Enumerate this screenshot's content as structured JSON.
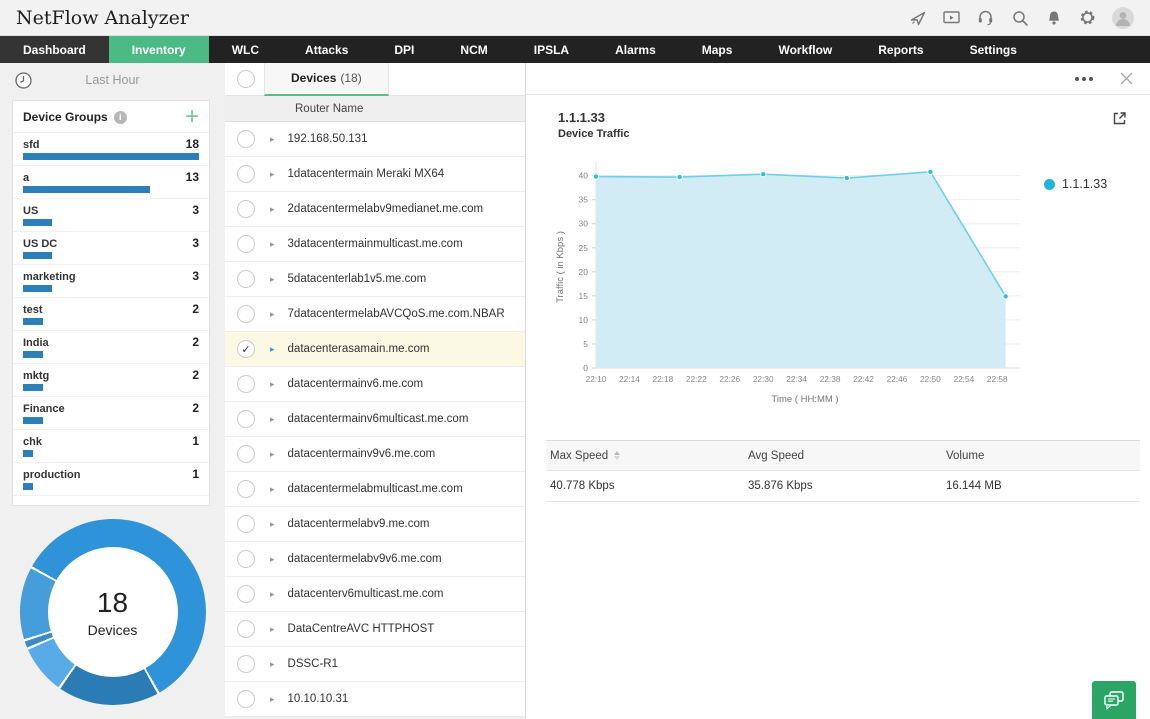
{
  "app": {
    "title": "NetFlow Analyzer"
  },
  "header": {
    "icons": [
      "rocket-icon",
      "demo-screen-icon",
      "support-headset-icon",
      "search-icon",
      "notifications-bell-icon",
      "settings-gear-icon",
      "user-avatar"
    ]
  },
  "nav": {
    "items": [
      "Dashboard",
      "Inventory",
      "WLC",
      "Attacks",
      "DPI",
      "NCM",
      "IPSLA",
      "Alarms",
      "Maps",
      "Workflow",
      "Reports",
      "Settings"
    ],
    "active_index": 1,
    "active_color": "#4cba85"
  },
  "sidebar": {
    "time_filter": {
      "label": "Last Hour"
    },
    "device_groups": {
      "title": "Device Groups",
      "info_glyph": "i",
      "add_glyph": "+",
      "bar_color": "#2d7fb9",
      "max_count": 18,
      "items": [
        {
          "label": "sfd",
          "count": 18
        },
        {
          "label": "a",
          "count": 13
        },
        {
          "label": "US",
          "count": 3
        },
        {
          "label": "US DC",
          "count": 3
        },
        {
          "label": "marketing",
          "count": 3
        },
        {
          "label": "test",
          "count": 2
        },
        {
          "label": "India",
          "count": 2
        },
        {
          "label": "mktg",
          "count": 2
        },
        {
          "label": "Finance",
          "count": 2
        },
        {
          "label": "chk",
          "count": 1
        },
        {
          "label": "production",
          "count": 1
        }
      ]
    },
    "donut": {
      "center_value": "18",
      "center_label": "Devices",
      "segments": [
        {
          "color": "#2e93d8",
          "deg": 150
        },
        {
          "color": "#2b7cb5",
          "deg": 63
        },
        {
          "color": "#58abe6",
          "deg": 30
        },
        {
          "color": "#3a8cc9",
          "deg": 4
        },
        {
          "color": "#459ed9",
          "deg": 45
        },
        {
          "color": "#2e93d8",
          "deg": 60
        }
      ]
    }
  },
  "devices_panel": {
    "tab": {
      "label": "Devices",
      "count": "(18)"
    },
    "column_header": "Router Name",
    "chevron_glyph": "▸",
    "check_glyph": "✓",
    "selected_row_color": "#fbf9e3",
    "rows": [
      {
        "name": "192.168.50.131",
        "selected": false
      },
      {
        "name": "1datacentermain Meraki MX64",
        "selected": false
      },
      {
        "name": "2datacentermelabv9medianet.me.com",
        "selected": false
      },
      {
        "name": "3datacentermainmulticast.me.com",
        "selected": false
      },
      {
        "name": "5datacenterlab1v5.me.com",
        "selected": false
      },
      {
        "name": "7datacentermelabAVCQoS.me.com.NBAR",
        "selected": false
      },
      {
        "name": "datacenterasamain.me.com",
        "selected": true
      },
      {
        "name": "datacentermainv6.me.com",
        "selected": false
      },
      {
        "name": "datacentermainv6multicast.me.com",
        "selected": false
      },
      {
        "name": "datacentermainv9v6.me.com",
        "selected": false
      },
      {
        "name": "datacentermelabmulticast.me.com",
        "selected": false
      },
      {
        "name": "datacentermelabv9.me.com",
        "selected": false
      },
      {
        "name": "datacentermelabv9v6.me.com",
        "selected": false
      },
      {
        "name": "datacenterv6multicast.me.com",
        "selected": false
      },
      {
        "name": "DataCentreAVC HTTPHOST",
        "selected": false
      },
      {
        "name": "DSSC-R1",
        "selected": false
      },
      {
        "name": "10.10.10.31",
        "selected": false
      }
    ]
  },
  "detail_panel": {
    "device_title": "1.1.1.33",
    "widget_title": "Device Traffic",
    "legend_label": "1.1.1.33",
    "legend_color": "#1fb6dc",
    "summary_table": {
      "headers": [
        "Max Speed",
        "Avg Speed",
        "Volume"
      ],
      "sorted_column": "Max Speed",
      "row": [
        "40.778 Kbps",
        "35.876 Kbps",
        "16.144 MB"
      ]
    },
    "chat_button_color": "#2aa566"
  },
  "chart_data": {
    "type": "area",
    "title": "Device Traffic",
    "xlabel": "Time ( HH:MM )",
    "ylabel": "Traffic ( in Kbps )",
    "ylim": [
      0,
      42
    ],
    "y_ticks": [
      0,
      5,
      10,
      15,
      20,
      25,
      30,
      35,
      40
    ],
    "x_tick_labels": [
      "22:10",
      "22:14",
      "22:18",
      "22:22",
      "22:26",
      "22:30",
      "22:34",
      "22:38",
      "22:42",
      "22:46",
      "22:50",
      "22:54",
      "22:58"
    ],
    "x_tick_minutes": [
      0,
      4,
      8,
      12,
      16,
      20,
      24,
      28,
      32,
      36,
      40,
      44,
      48
    ],
    "x_range_minutes": [
      0,
      50
    ],
    "grid": true,
    "legend_position": "right",
    "series": [
      {
        "name": "1.1.1.33",
        "x": [
          "22:10",
          "22:20",
          "22:30",
          "22:40",
          "22:50",
          "22:59"
        ],
        "x_minutes": [
          0,
          10,
          20,
          30,
          40,
          49
        ],
        "values": [
          39.8,
          39.7,
          40.3,
          39.5,
          40.778,
          14.9
        ]
      }
    ],
    "colors": {
      "line": "#6fcfe9",
      "fill": "#d2ecf6",
      "marker": "#2fbde2"
    }
  }
}
